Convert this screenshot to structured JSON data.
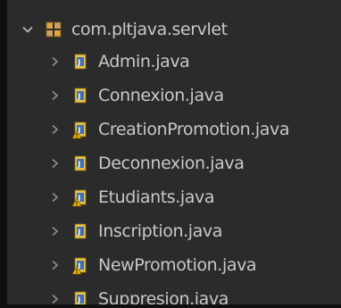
{
  "tree": {
    "package": {
      "label": "com.pltjava.servlet",
      "icon": "package-icon",
      "expanded": true
    },
    "items": [
      {
        "label": "Admin.java",
        "icon": "java-file-icon",
        "warning": false
      },
      {
        "label": "Connexion.java",
        "icon": "java-file-icon",
        "warning": false
      },
      {
        "label": "CreationPromotion.java",
        "icon": "java-file-warning-icon",
        "warning": true
      },
      {
        "label": "Deconnexion.java",
        "icon": "java-file-icon",
        "warning": false
      },
      {
        "label": "Etudiants.java",
        "icon": "java-file-warning-icon",
        "warning": true
      },
      {
        "label": "Inscription.java",
        "icon": "java-file-icon",
        "warning": false
      },
      {
        "label": "NewPromotion.java",
        "icon": "java-file-warning-icon",
        "warning": true
      },
      {
        "label": "Suppresion.java",
        "icon": "java-file-icon",
        "warning": false
      }
    ]
  },
  "colors": {
    "background": "#2b2b2b",
    "text": "#c8c8c8",
    "chevron": "#9a9a9a",
    "file_icon_blue": "#3f6fb5",
    "file_icon_yellow": "#e8c34a",
    "warning": "#e8b600"
  }
}
